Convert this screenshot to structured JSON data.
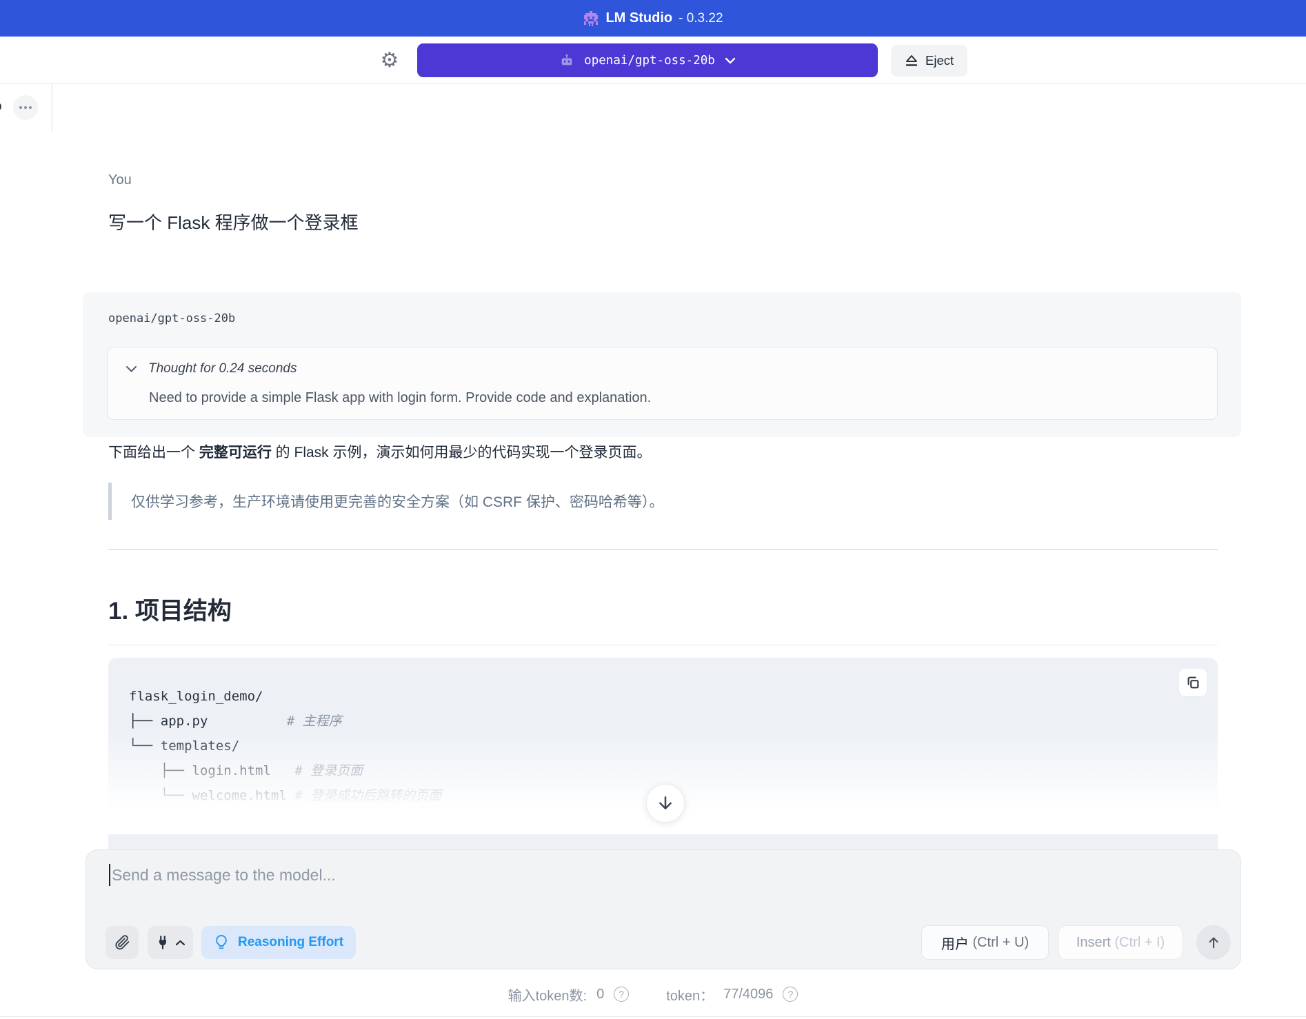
{
  "titlebar": {
    "app_name": "LM Studio",
    "version": "- 0.3.22"
  },
  "toolbar": {
    "model_selector_label": "openai/gpt-oss-20b",
    "eject_label": "Eject"
  },
  "tabbar": {
    "truncated_tab_text": "o"
  },
  "chat": {
    "user_label": "You",
    "user_message": "写一个 Flask 程序做一个登录框",
    "assistant_model_name": "openai/gpt-oss-20b",
    "thought": {
      "summary": "Thought for 0.24 seconds",
      "content": "Need to provide a simple Flask app with login form. Provide code and explanation."
    },
    "paragraph": {
      "pre": "下面给出一个 ",
      "bold": "完整可运行",
      "post": " 的 Flask 示例，演示如何用最少的代码实现一个登录页面。"
    },
    "blockquote": "仅供学习参考，生产环境请使用更完善的安全方案（如 CSRF 保护、密码哈希等）。",
    "heading": "1. 项目结构",
    "code_block": {
      "lines": [
        {
          "code": "flask_login_demo/",
          "comment": ""
        },
        {
          "code": "├── app.py          ",
          "comment": "# 主程序"
        },
        {
          "code": "└── templates/",
          "comment": ""
        },
        {
          "code": "    ├── login.html   ",
          "comment": "# 登录页面"
        },
        {
          "code": "    └── welcome.html ",
          "comment": "# 登录成功后跳转的页面"
        }
      ]
    }
  },
  "composer": {
    "placeholder": "Send a message to the model...",
    "reasoning_effort_label": "Reasoning Effort",
    "user_role_label": "用户",
    "user_role_shortcut": " (Ctrl + U)",
    "insert_label": "Insert",
    "insert_shortcut": " (Ctrl + I)"
  },
  "statusbar": {
    "input_tokens_label": "输入token数:",
    "input_tokens_value": "0",
    "context_label": "token：",
    "context_value": "77/4096"
  },
  "colors": {
    "titlebar_blue": "#2e55da",
    "model_button_purple": "#4c38d4",
    "logo_purple": "#b583ec",
    "reasoning_blue": "#2299f2",
    "reasoning_bg": "#dbe8fb",
    "assistant_bubble_gray": "#f6f7f8",
    "code_block_bg": "#edf1f6"
  }
}
